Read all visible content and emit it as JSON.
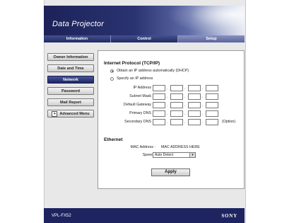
{
  "header": {
    "title": "Data Projector"
  },
  "tabs": [
    {
      "label": "Information"
    },
    {
      "label": "Control"
    },
    {
      "label": "Setup"
    }
  ],
  "sidebar": {
    "items": [
      {
        "label": "Owner Information"
      },
      {
        "label": "Date and Time"
      },
      {
        "label": "Network"
      },
      {
        "label": "Password"
      },
      {
        "label": "Mail Report"
      },
      {
        "label": "Advanced Menu",
        "expander": "+"
      }
    ]
  },
  "tcpip": {
    "title": "Internet Protocol (TCP/IP)",
    "option_auto": "Obtain an IP address automatically (DHCP)",
    "option_manual": "Specify an IP address",
    "selected": "auto",
    "fields": [
      {
        "label": "IP Address :"
      },
      {
        "label": "Subnet Mask :"
      },
      {
        "label": "Default Gateway :"
      },
      {
        "label": "Primary DNS :"
      },
      {
        "label": "Secondary DNS :",
        "note": "(Option)"
      }
    ],
    "dot": "."
  },
  "ethernet": {
    "title": "Ethernet",
    "mac_label": "MAC Address :",
    "mac_value": "MAC ADDRESS HERE",
    "speed_label": "Speed :",
    "speed_value": "Auto Detect"
  },
  "apply_label": "Apply",
  "footer": {
    "model": "VPL-FX52",
    "brand": "SONY"
  },
  "colors": {
    "navy": "#1e2460",
    "tab_active": "#6a74aa",
    "panel_bg": "#e8e8e8"
  }
}
